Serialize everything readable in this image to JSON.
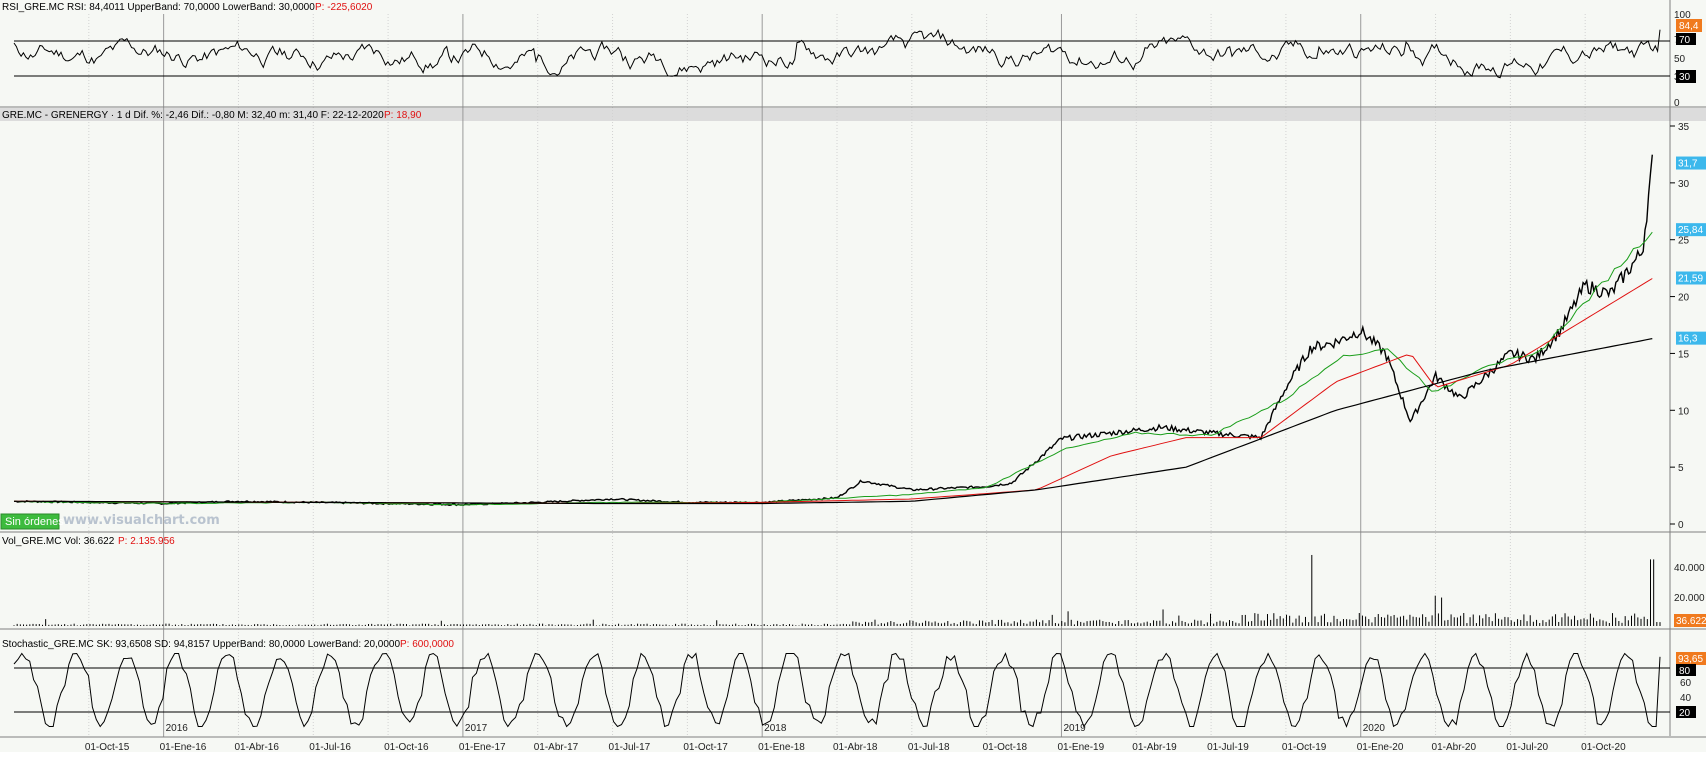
{
  "colors": {
    "background": "#f6f8f4",
    "price_line": "#000000",
    "ma_fast": "#1a9e1a",
    "ma_mid": "#e01010",
    "ma_slow": "#000000",
    "label_cyan": "#3cb8ec",
    "label_orange": "#f07a1e",
    "label_black": "#000000",
    "status_green": "#3dbb3d"
  },
  "watermark": "www.visualchart.com",
  "status_badge": "Sin órdenes",
  "panels": {
    "rsi": {
      "header": "RSI_GRE.MC  RSI: 84,4011  UpperBand: 70,0000  LowerBand: 30,0000",
      "header_red": "P: -225,6020",
      "ticks": [
        "100",
        "70",
        "50",
        "30",
        "0"
      ],
      "labels": {
        "current": "84,4",
        "upper": "70",
        "lower": "30"
      }
    },
    "price": {
      "header": "GRE.MC - GRENERGY · 1 d  Dif. %: -2,46  Dif.: -0,80  M: 32,40  m: 31,40  F: 22-12-2020",
      "header_red": "P: 18,90",
      "ticks": [
        "35",
        "30",
        "25",
        "20",
        "15",
        "10",
        "5",
        "0"
      ],
      "labels": {
        "last": "31,7",
        "ma_fast": "25,84",
        "ma_mid": "21,59",
        "ma_slow": "16,3"
      }
    },
    "volume": {
      "header": "Vol_GRE.MC  Vol: 36.622",
      "header_red": "P: 2.135.956",
      "ticks": [
        "40.000",
        "20.000"
      ],
      "labels": {
        "current": "36.622"
      }
    },
    "stochastic": {
      "header": "Stochastic_GRE.MC  SK: 93,6508  SD: 94,8157  UpperBand: 80,0000  LowerBand: 20,0000",
      "header_red": "P: 600,0000",
      "ticks": [
        "80",
        "60",
        "40",
        "20"
      ],
      "labels": {
        "current": "93,65",
        "upper": "80",
        "lower": "20"
      }
    }
  },
  "x_axis": {
    "dates": [
      "01-Oct-15",
      "01-Ene-16",
      "01-Abr-16",
      "01-Jul-16",
      "01-Oct-16",
      "01-Ene-17",
      "01-Abr-17",
      "01-Jul-17",
      "01-Oct-17",
      "01-Ene-18",
      "01-Abr-18",
      "01-Jul-18",
      "01-Oct-18",
      "01-Ene-19",
      "01-Abr-19",
      "01-Jul-19",
      "01-Oct-19",
      "01-Ene-20",
      "01-Abr-20",
      "01-Jul-20",
      "01-Oct-20"
    ],
    "years": [
      "2016",
      "2017",
      "2018",
      "2019",
      "2020"
    ]
  },
  "chart_data": {
    "type": "line",
    "title": "GRE.MC - GRENERGY · 1 d",
    "x_range": [
      "2015-07",
      "2020-12"
    ],
    "price_ylim": [
      0,
      35
    ],
    "series": [
      {
        "name": "GRE.MC",
        "x": [
          "2015-07",
          "2015-10",
          "2016-01",
          "2016-04",
          "2016-07",
          "2016-10",
          "2017-01",
          "2017-04",
          "2017-07",
          "2017-10",
          "2018-01",
          "2018-04",
          "2018-05",
          "2018-07",
          "2018-10",
          "2018-11",
          "2019-01",
          "2019-03",
          "2019-05",
          "2019-07",
          "2019-09",
          "2019-10",
          "2019-11",
          "2019-12",
          "2020-01",
          "2020-02",
          "2020-03",
          "2020-04",
          "2020-05",
          "2020-07",
          "2020-08",
          "2020-09",
          "2020-10",
          "2020-11",
          "2020-12-10",
          "2020-12-22"
        ],
        "values": [
          2.0,
          1.9,
          1.8,
          2.0,
          1.9,
          1.8,
          1.7,
          1.9,
          2.2,
          1.9,
          1.9,
          2.3,
          3.8,
          3.0,
          3.3,
          3.6,
          7.5,
          8.0,
          8.5,
          8.0,
          7.6,
          12.0,
          15.5,
          16.0,
          17.0,
          15.0,
          9.0,
          13.0,
          11.0,
          15.0,
          14.5,
          17.0,
          21.0,
          20.2,
          24.0,
          31.7
        ]
      },
      {
        "name": "",
        "x": [
          "2015-07",
          "2016-01",
          "2016-07",
          "2017-01",
          "2017-07",
          "2018-01",
          "2018-07",
          "2018-10",
          "2019-01",
          "2019-04",
          "2019-07",
          "2019-10",
          "2019-12",
          "2020-02",
          "2020-04",
          "2020-06",
          "2020-08",
          "2020-10",
          "2020-12-22"
        ],
        "values": [
          2.0,
          1.8,
          1.9,
          1.7,
          1.9,
          1.9,
          2.6,
          3.2,
          6.5,
          8.0,
          7.8,
          11.0,
          14.5,
          15.5,
          11.5,
          14.0,
          14.8,
          19.5,
          25.84
        ]
      },
      {
        "name": "",
        "x": [
          "2015-07",
          "2016-07",
          "2017-07",
          "2018-01",
          "2018-07",
          "2018-12",
          "2019-03",
          "2019-06",
          "2019-09",
          "2019-12",
          "2020-03",
          "2020-04",
          "2020-07",
          "2020-10",
          "2020-12-22"
        ],
        "values": [
          2.0,
          1.9,
          1.8,
          1.9,
          2.2,
          3.0,
          6.0,
          7.6,
          7.6,
          12.5,
          15.0,
          12.0,
          14.0,
          18.0,
          21.59
        ]
      },
      {
        "name": "",
        "x": [
          "2015-07",
          "2016-07",
          "2017-07",
          "2018-01",
          "2018-07",
          "2018-12",
          "2019-06",
          "2019-12",
          "2020-06",
          "2020-12-22"
        ],
        "values": [
          2.0,
          1.9,
          1.8,
          1.8,
          2.0,
          3.0,
          5.0,
          10.0,
          13.5,
          16.3
        ]
      }
    ],
    "rsi": {
      "name": "RSI",
      "bands": [
        30,
        70
      ],
      "ylim": [
        0,
        100
      ],
      "last": 84.4011
    },
    "volume": {
      "name": "Vol",
      "ylim": [
        0,
        50000
      ],
      "last": 36622,
      "spikes": [
        {
          "x": "2019-11",
          "v": 48000
        },
        {
          "x": "2020-12-22",
          "v": 45000
        }
      ]
    },
    "stochastic": {
      "name": "Stochastic",
      "bands": [
        20,
        80
      ],
      "ylim": [
        0,
        100
      ],
      "sk": 93.6508,
      "sd": 94.8157
    }
  }
}
